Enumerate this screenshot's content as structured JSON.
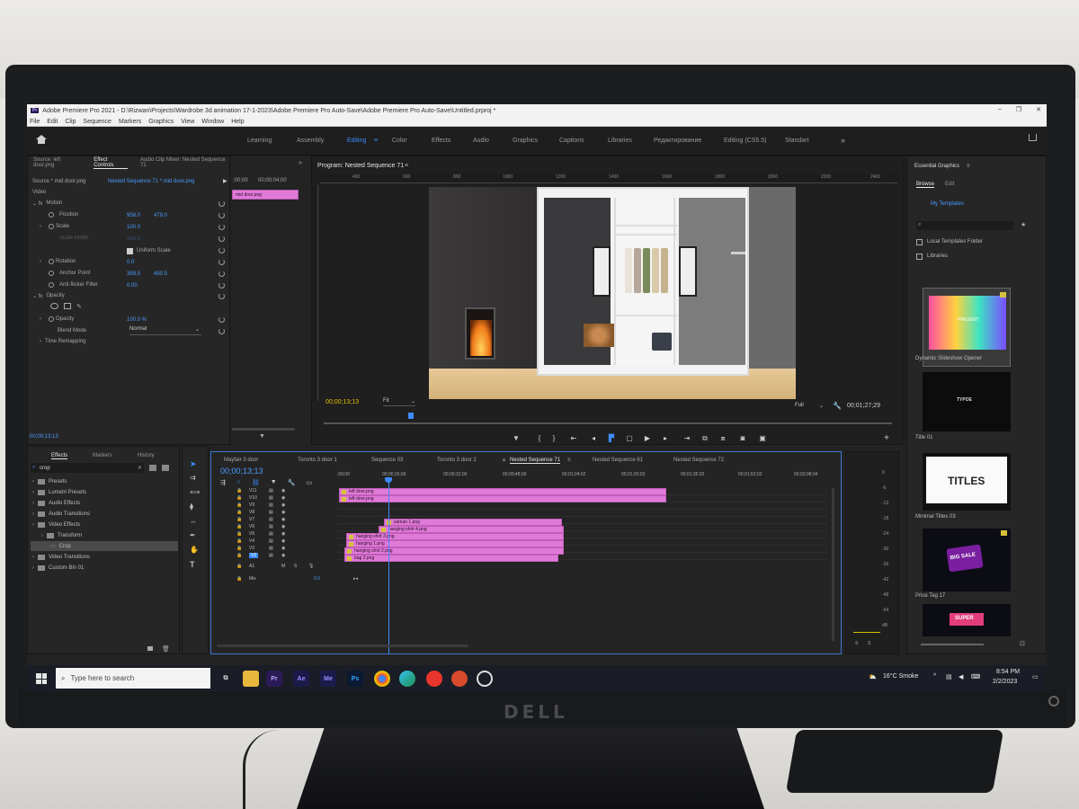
{
  "app": {
    "badge": "Pr",
    "title": "Adobe Premiere Pro 2021 - D:\\Rizwan\\Projects\\Wardrobe 3d animation 17-1-2023\\Adobe Premiere Pro Auto-Save\\Adobe Premiere Pro Auto-Save\\Untitled.prproj *",
    "window_controls": [
      "–",
      "❐",
      "✕"
    ]
  },
  "menu": [
    "File",
    "Edit",
    "Clip",
    "Sequence",
    "Markers",
    "Graphics",
    "View",
    "Window",
    "Help"
  ],
  "workspaces": {
    "tabs": [
      "Learning",
      "Assembly",
      "Editing",
      "Color",
      "Effects",
      "Audio",
      "Graphics",
      "Captions",
      "Libraries",
      "Редактирование",
      "Editing (CS5.5)",
      "Standart"
    ],
    "active": "Editing",
    "more": "»"
  },
  "source_panel": {
    "tabs": [
      "Source: left door.png",
      "Effect Controls",
      "Audio Clip Mixer: Nested Sequence 71",
      "»"
    ],
    "active_tab": "Effect Controls",
    "source_label": "Source * mid door.png",
    "sequence_label": "Nested Sequence 71 * mid door.png",
    "timecode_start": ";00;00",
    "timecode_end": "00;00;04;00",
    "clip_name": "mid door.png",
    "section_video": "Video",
    "motion": "Motion",
    "position_label": "Position",
    "position_x": "958.0",
    "position_y": "479.0",
    "scale_label": "Scale",
    "scale_value": "100.0",
    "scale_width_label": "Scale Width",
    "scale_width_value": "100.0",
    "uniform_scale": "Uniform Scale",
    "rotation_label": "Rotation",
    "rotation_value": "0.0",
    "anchor_label": "Anchor Point",
    "anchor_x": "359.5",
    "anchor_y": "450.5",
    "flicker_label": "Anti-flicker Filter",
    "flicker_value": "0.00",
    "opacity_section": "Opacity",
    "opacity_label": "Opacity",
    "opacity_value": "100.0 %",
    "blend_label": "Blend Mode",
    "blend_value": "Normal",
    "time_remap": "Time Remapping",
    "footer_timecode": "00;00;13;13"
  },
  "program": {
    "title": "Program: Nested Sequence 71",
    "ruler_ticks": [
      "400",
      "600",
      "800",
      "1000",
      "1200",
      "1400",
      "1600",
      "1800",
      "2000",
      "2200",
      "2400"
    ],
    "timecode": "00;00;13;13",
    "fit": "Fit",
    "quality": "Full",
    "duration": "00;01;27;29"
  },
  "effects_panel": {
    "tabs": [
      "Effects",
      "Markers",
      "History"
    ],
    "active_tab": "Effects",
    "search_value": "crop",
    "tree": [
      {
        "label": "Presets",
        "level": 0
      },
      {
        "label": "Lumetri Presets",
        "level": 0
      },
      {
        "label": "Audio Effects",
        "level": 0
      },
      {
        "label": "Audio Transitions",
        "level": 0
      },
      {
        "label": "Video Effects",
        "level": 0
      },
      {
        "label": "Transform",
        "level": 1
      },
      {
        "label": "Crop",
        "level": 2
      },
      {
        "label": "Video Transitions",
        "level": 0
      },
      {
        "label": "Custom Bin 01",
        "level": 0
      }
    ]
  },
  "timeline": {
    "tabs": [
      "Mayfair 3 door",
      "Toronto 3 door 1",
      "Sequence 03",
      "Toronto 3 door 2",
      "Nested Sequence 71",
      "Nested Sequence 61",
      "Nested Sequence 72"
    ],
    "active_tab": "Nested Sequence 71",
    "timecode": "00;00;13;13",
    "ruler": [
      ";00;00",
      "00;00;16;00",
      "00;00;32;00",
      "00;00;48;00",
      "00;01;04;02",
      "00;01;20;02",
      "00;01;36;02",
      "00;01;52;02",
      "00;02;08;04"
    ],
    "tracks": [
      "V11",
      "V10",
      "V9",
      "V8",
      "V7",
      "V6",
      "V5",
      "V4",
      "V3",
      "V2"
    ],
    "audio_track": "A1",
    "audio_m": "M",
    "audio_s": "S",
    "mix_label": "Mix",
    "mix_value": "0.0",
    "clips": [
      "left door.png",
      "left door.png",
      "saman 1.png",
      "hanging shirt 4.png",
      "hanging shirt 3.png",
      "hanging 1.png",
      "hanging shirt 2.png",
      "bag 2.png"
    ]
  },
  "meter": {
    "labels": [
      "0",
      "-6",
      "-12",
      "-18",
      "-24",
      "-30",
      "-36",
      "-42",
      "-48",
      "-54",
      "dB"
    ],
    "solo": [
      "S",
      "S"
    ]
  },
  "essential_graphics": {
    "title": "Essential Graphics",
    "tabs": [
      "Browse",
      "Edit"
    ],
    "active_tab": "Browse",
    "my_templates": "My Templates",
    "local_folder": "Local Templates Folder",
    "libraries": "Libraries",
    "templates": [
      {
        "name": "Dynamic Slideshow Opener",
        "preview_text": "PRESENT"
      },
      {
        "name": "Title 01",
        "preview_text": "TYPOE"
      },
      {
        "name": "Minimal Titles 03",
        "preview_text": "TITLES"
      },
      {
        "name": "Price Tag 17",
        "preview_text": "BIG SALE"
      },
      {
        "name": "",
        "preview_text": "SUPER"
      }
    ]
  },
  "taskbar": {
    "search_placeholder": "Type here to search",
    "apps": [
      "Pr",
      "Ae",
      "Me",
      "Ps"
    ],
    "weather": "16°C  Smoke",
    "time": "8:54 PM",
    "date": "2/2/2023"
  },
  "monitor": {
    "brand": "DELL"
  },
  "colors": {
    "accent_blue": "#3d8bff",
    "clip_pink": "#e07ad8",
    "panel_bg": "#262626",
    "premiere_badge": "#2a1a55"
  }
}
